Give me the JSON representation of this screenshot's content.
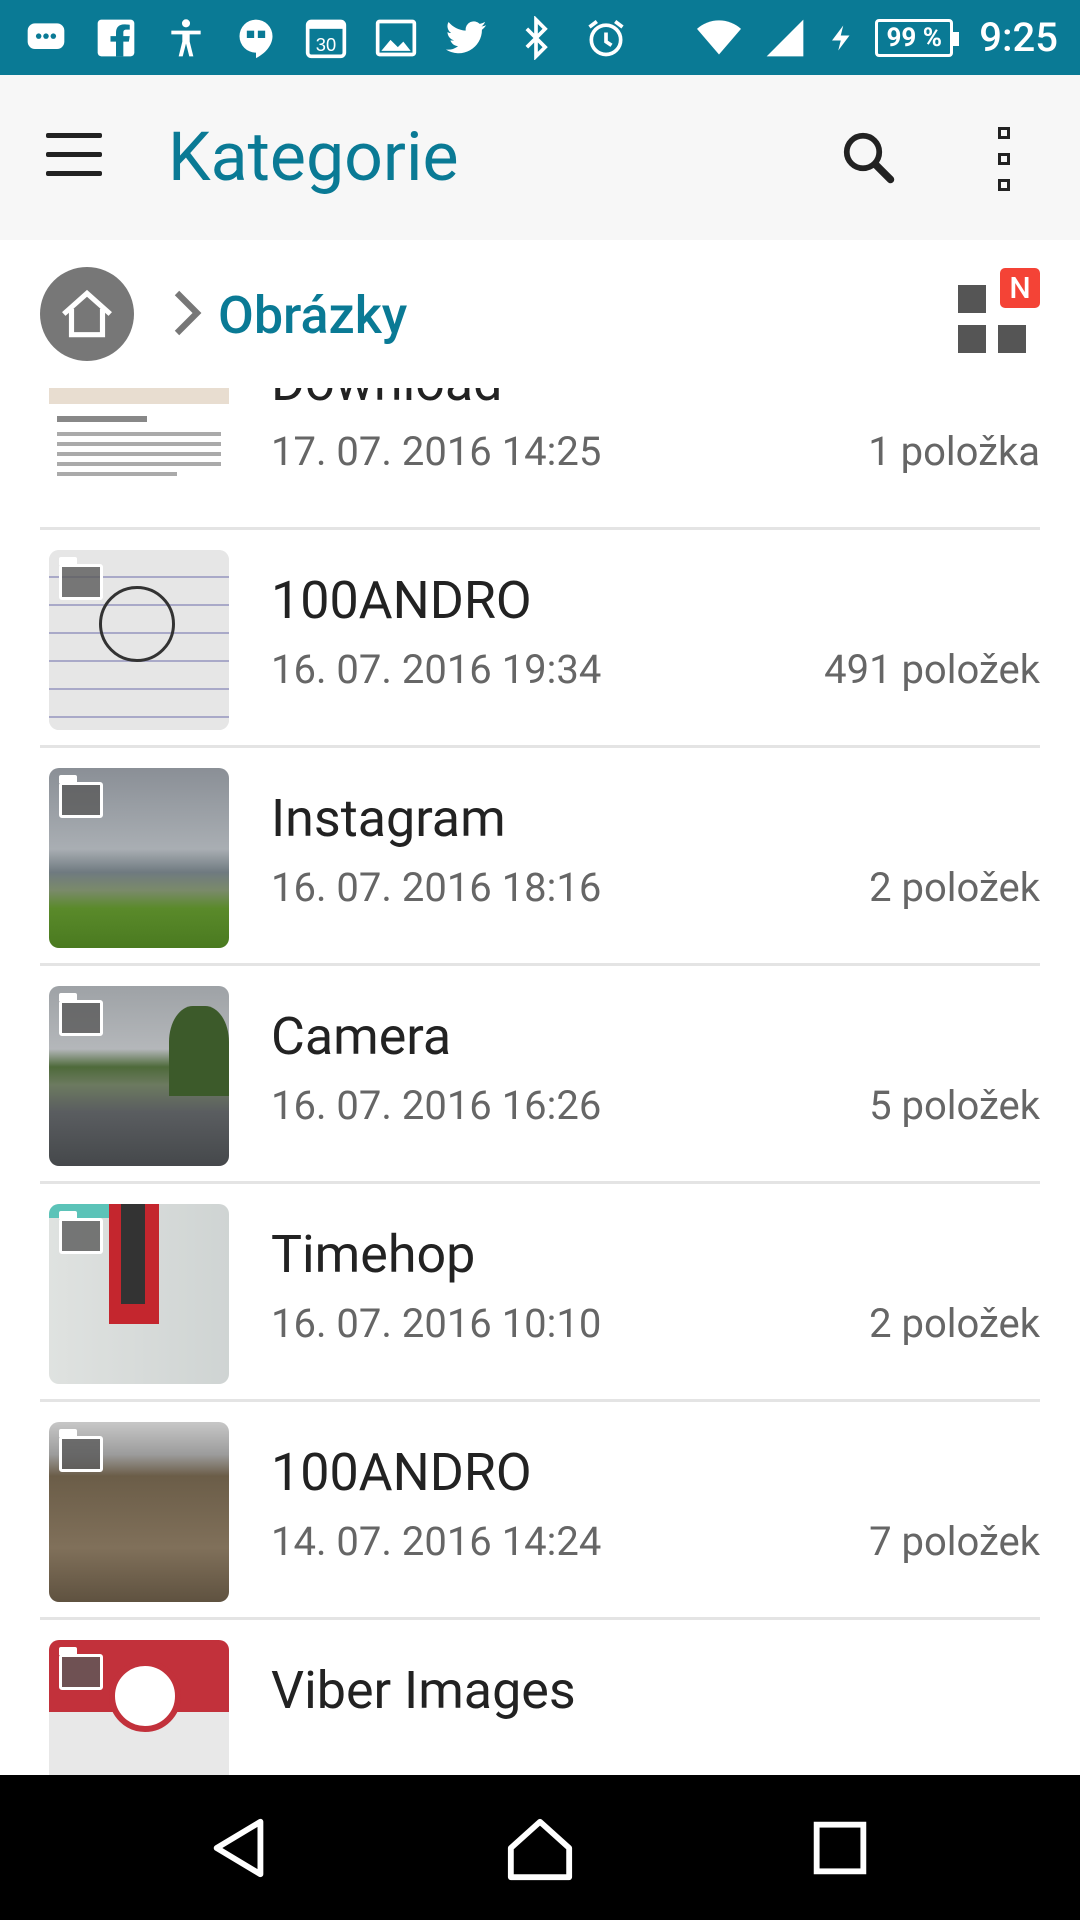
{
  "status_bar": {
    "time": "9:25",
    "battery_percent": "99 %",
    "icons": [
      "messages-icon",
      "facebook-icon",
      "accessibility-icon",
      "hangouts-icon",
      "calendar-icon",
      "gallery-icon",
      "twitter-icon",
      "bluetooth-icon",
      "alarm-icon",
      "wifi-icon",
      "signal-icon",
      "charging-icon"
    ],
    "calendar_day": "30"
  },
  "toolbar": {
    "title": "Kategorie"
  },
  "breadcrumb": {
    "current": "Obrázky",
    "badge": "N"
  },
  "folders": [
    {
      "name": "Download",
      "date": "17. 07. 2016 14:25",
      "count": "1 položka"
    },
    {
      "name": "100ANDRO",
      "date": "16. 07. 2016 19:34",
      "count": "491 položek"
    },
    {
      "name": "Instagram",
      "date": "16. 07. 2016 18:16",
      "count": "2 položek"
    },
    {
      "name": "Camera",
      "date": "16. 07. 2016 16:26",
      "count": "5 položek"
    },
    {
      "name": "Timehop",
      "date": "16. 07. 2016 10:10",
      "count": "2 položek"
    },
    {
      "name": "100ANDRO",
      "date": "14. 07. 2016 14:24",
      "count": "7 položek"
    },
    {
      "name": "Viber Images",
      "date": "",
      "count": ""
    }
  ],
  "colors": {
    "accent": "#0a7a95",
    "badge": "#f44336"
  }
}
